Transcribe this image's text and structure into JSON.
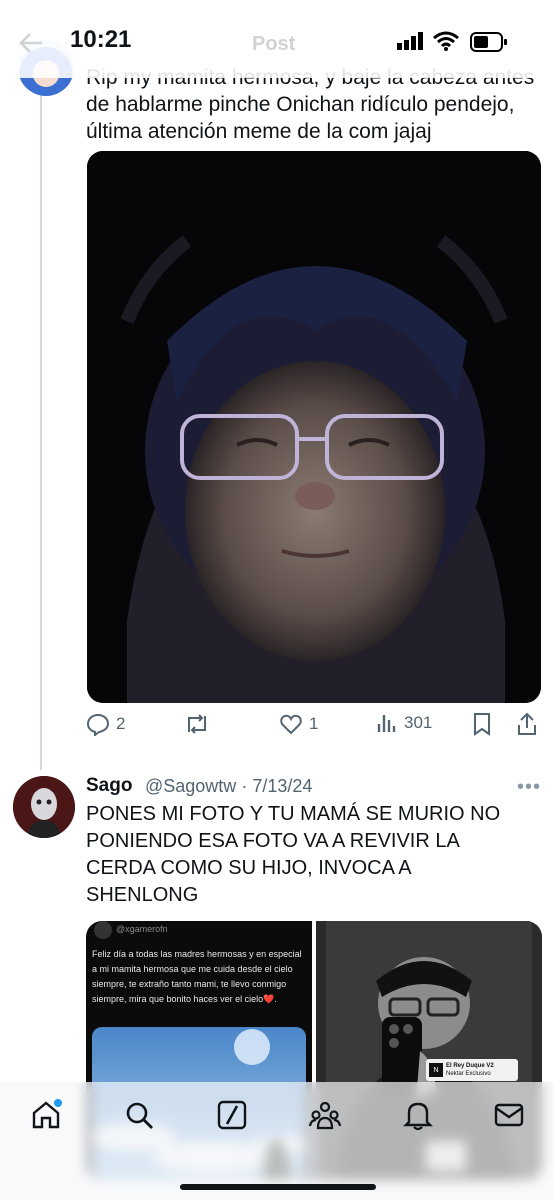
{
  "status_bar": {
    "time": "10:21"
  },
  "header": {
    "title": "Post"
  },
  "tweet1": {
    "text_lines": [
      "Rip my mamita hermosa, y baje la cabeza antes",
      "de hablarme pinche Onichan ridículo pendejo,",
      "última atención meme de la com jajaj"
    ],
    "replies": "2",
    "reposts": "",
    "likes": "1",
    "views": "301"
  },
  "tweet2": {
    "name": "Sago",
    "handle": "@Sagowtw",
    "date": "· 7/13/24",
    "text_lines": [
      "PONES MI FOTO Y TU MAMÁ SE MURIO NO",
      "PONIENDO ESA FOTO VA A REVIVIR LA",
      "CERDA COMO SU HIJO, INVOCA A",
      "SHENLONG"
    ],
    "embed_left": {
      "handle": "@xgamerofn",
      "text": "Feliz día a todas las madres hermosas y en especial a mi mamita hermosa que me cuida desde el cielo siempre, te extraño tanto mami, te llevo conmigo siempre, mira que bonito haces ver el cielo❤️."
    },
    "embed_right": {
      "badge_title": "El Rey Duque V2",
      "badge_sub": "Nektar Exclusivo"
    }
  },
  "colors": {
    "accent": "#1d9bf0",
    "muted": "#536471",
    "text": "#0f1419"
  },
  "nav": {
    "icons": [
      "home-icon",
      "search-icon",
      "grok-icon",
      "communities-icon",
      "notifications-icon",
      "messages-icon"
    ]
  }
}
